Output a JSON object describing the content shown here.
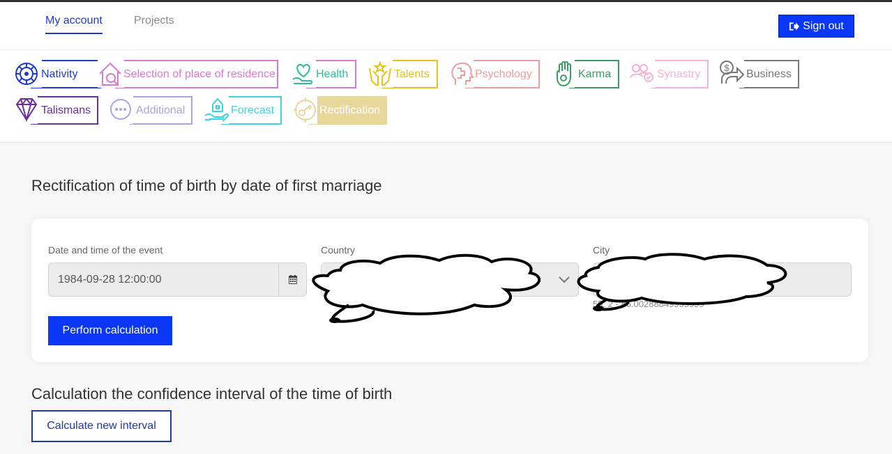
{
  "nav": {
    "account": "My account",
    "projects": "Projects",
    "signout": "Sign out"
  },
  "services": [
    {
      "label": "Nativity",
      "icon": "wheel-icon",
      "color": "#1d3ad1"
    },
    {
      "label": "Selection of place of residence",
      "icon": "house-search-icon",
      "color": "#d77ad0"
    },
    {
      "label": "Health",
      "icon": "heart-hand-icon",
      "color": "#2fbf95"
    },
    {
      "label": "Talents",
      "icon": "hands-star-icon",
      "color": "#e6c21a"
    },
    {
      "label": "Psychology",
      "icon": "head-puzzle-icon",
      "color": "#ee9d9a"
    },
    {
      "label": "Karma",
      "icon": "hamsa-icon",
      "color": "#3d9b63"
    },
    {
      "label": "Synastry",
      "icon": "people-icon",
      "color": "#f4b2d5"
    },
    {
      "label": "Business",
      "icon": "money-arrow-icon",
      "color": "#777777"
    },
    {
      "label": "Talismans",
      "icon": "diamond-icon",
      "color": "#6a2f9e"
    },
    {
      "label": "Additional",
      "icon": "dots-icon",
      "color": "#a9a3e6"
    },
    {
      "label": "Forecast",
      "icon": "house-hand-icon",
      "color": "#3cd5e0"
    },
    {
      "label": "Rectification",
      "icon": "key-target-icon",
      "color": "#e8d79a"
    }
  ],
  "rect": {
    "title": "Rectification of time of birth by date of first marriage",
    "date_label": "Date and time of the event",
    "date_value": "1984-09-28 12:00:00",
    "country_label": "Country",
    "city_label": "City",
    "coords_text": "55.      2 - 86.00288849999999",
    "perform_label": "Perform calculation"
  },
  "confidence": {
    "title": "Calculation the confidence interval of the time of birth",
    "button": "Calculate new interval"
  }
}
